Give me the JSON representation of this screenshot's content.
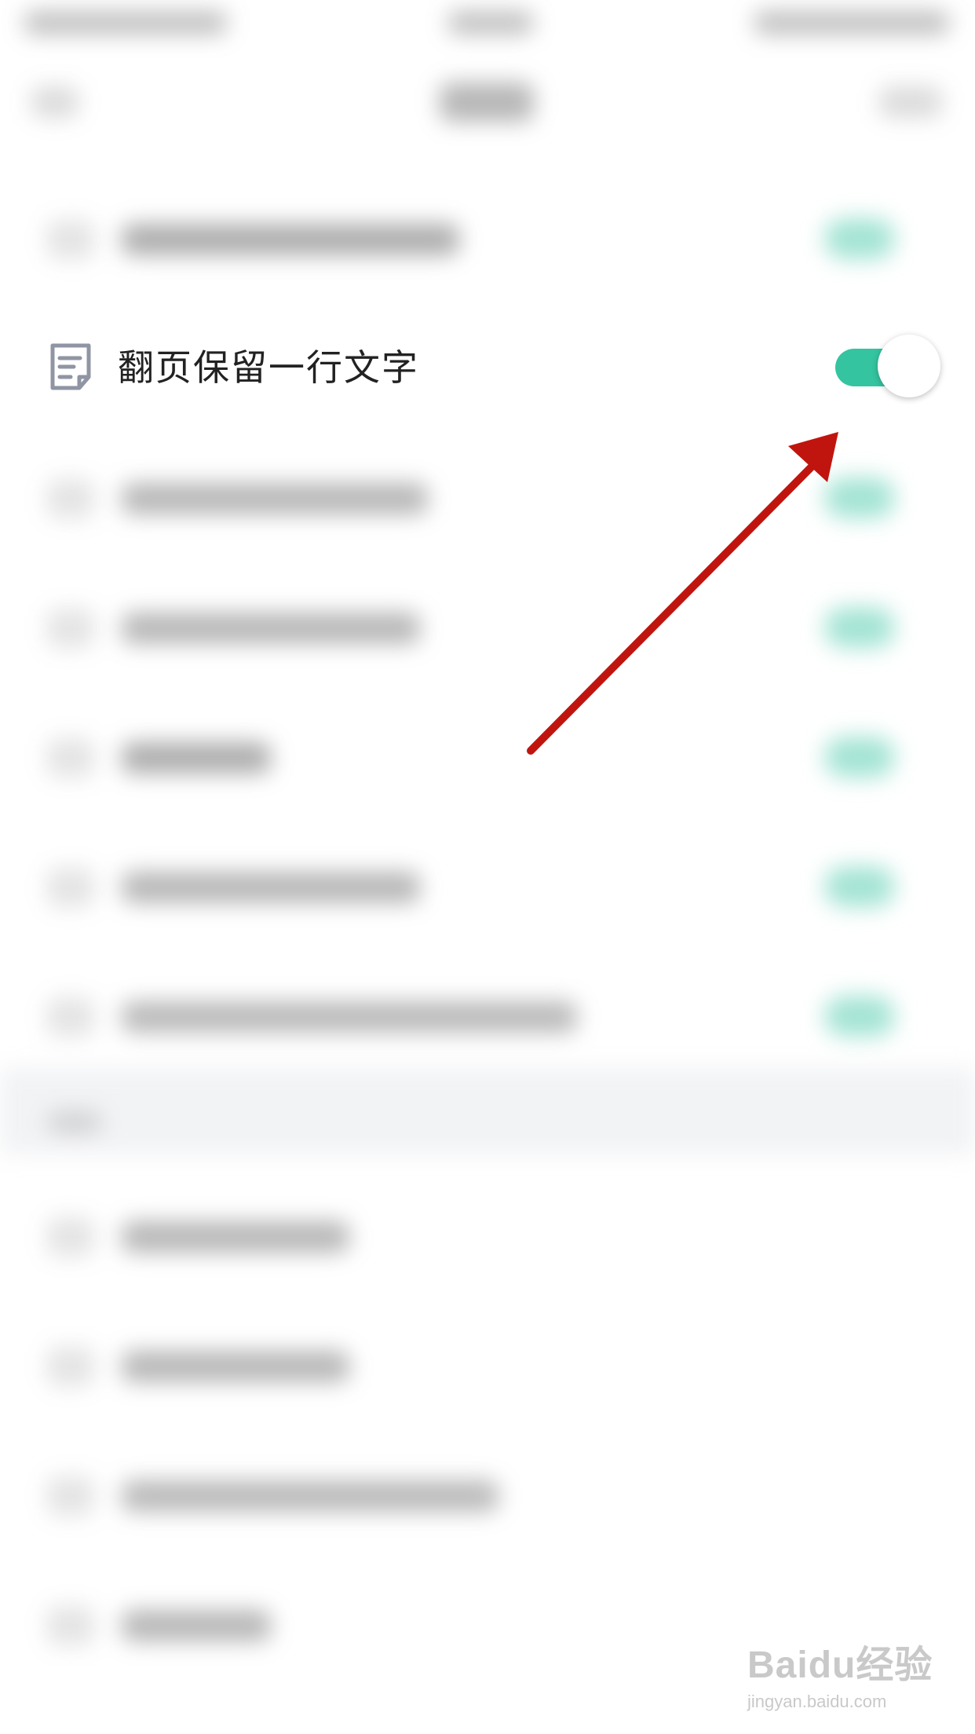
{
  "setting_row": {
    "label": "翻页保留一行文字",
    "icon": "document-edit-icon",
    "toggle_state": "on",
    "accent_color": "#35c4a0"
  },
  "annotation": {
    "arrow_color": "#c0150f"
  },
  "watermark": {
    "logo": "Baidu经验",
    "url": "jingyan.baidu.com"
  }
}
